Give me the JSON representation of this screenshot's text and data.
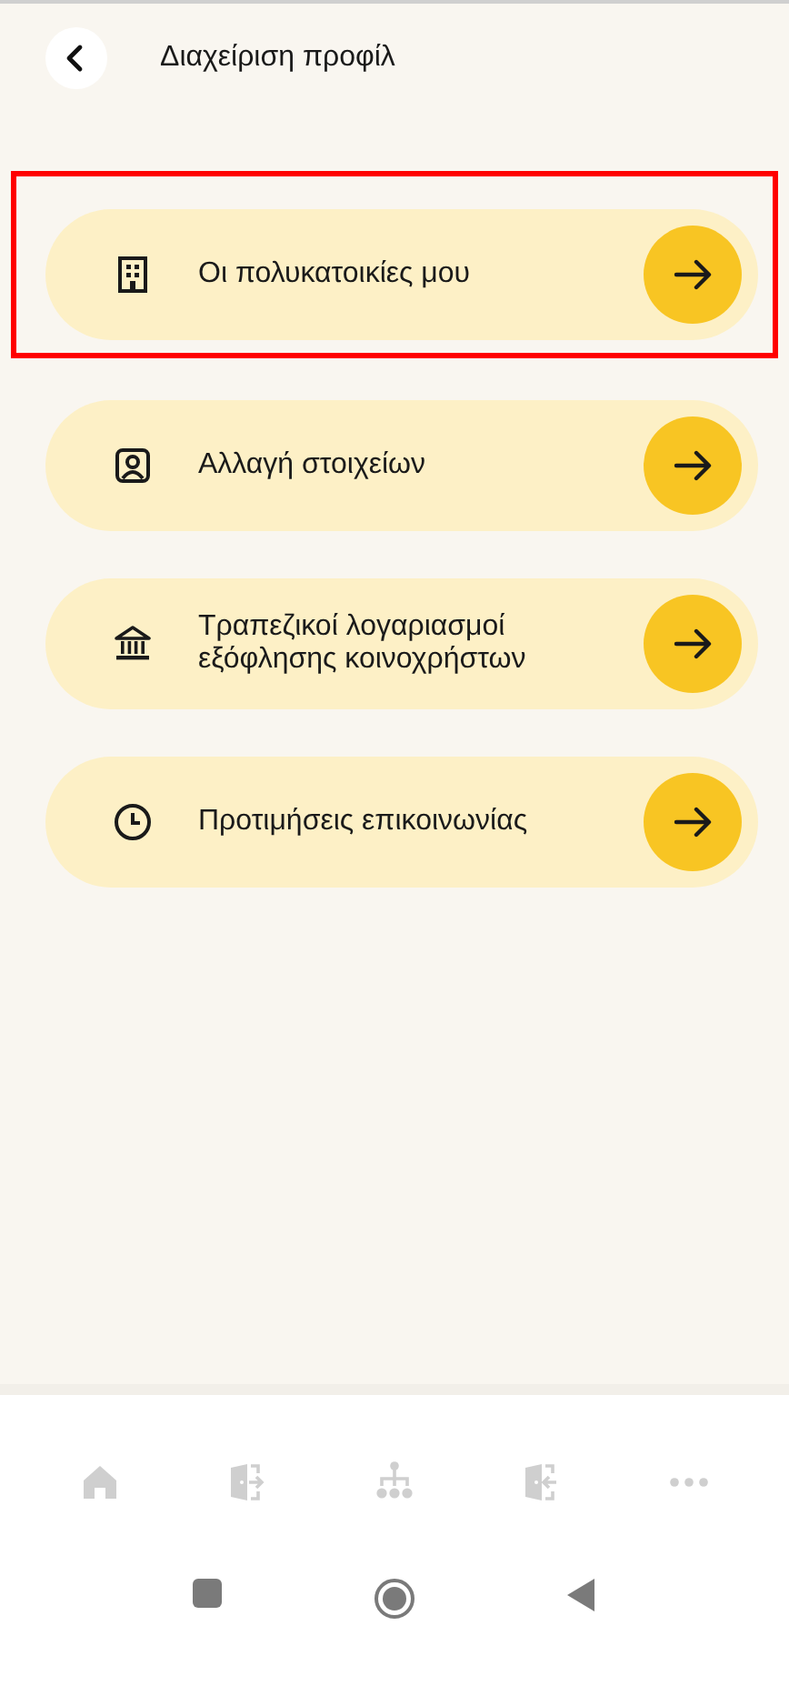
{
  "header": {
    "title": "Διαχείριση προφίλ"
  },
  "menu": [
    {
      "label": "Οι πολυκατοικίες μου",
      "kind": "building",
      "highlighted": true
    },
    {
      "label": "Αλλαγή στοιχείων",
      "kind": "person",
      "highlighted": false
    },
    {
      "label": "Τραπεζικοί λογαριασμοί εξόφλησης κοινοχρήστων",
      "kind": "bank",
      "highlighted": false
    },
    {
      "label": "Προτιμήσεις επικοινωνίας",
      "kind": "clock",
      "highlighted": false
    }
  ],
  "bottom_nav": [
    {
      "kind": "home"
    },
    {
      "kind": "door-out"
    },
    {
      "kind": "hierarchy"
    },
    {
      "kind": "door-in"
    },
    {
      "kind": "more"
    }
  ]
}
